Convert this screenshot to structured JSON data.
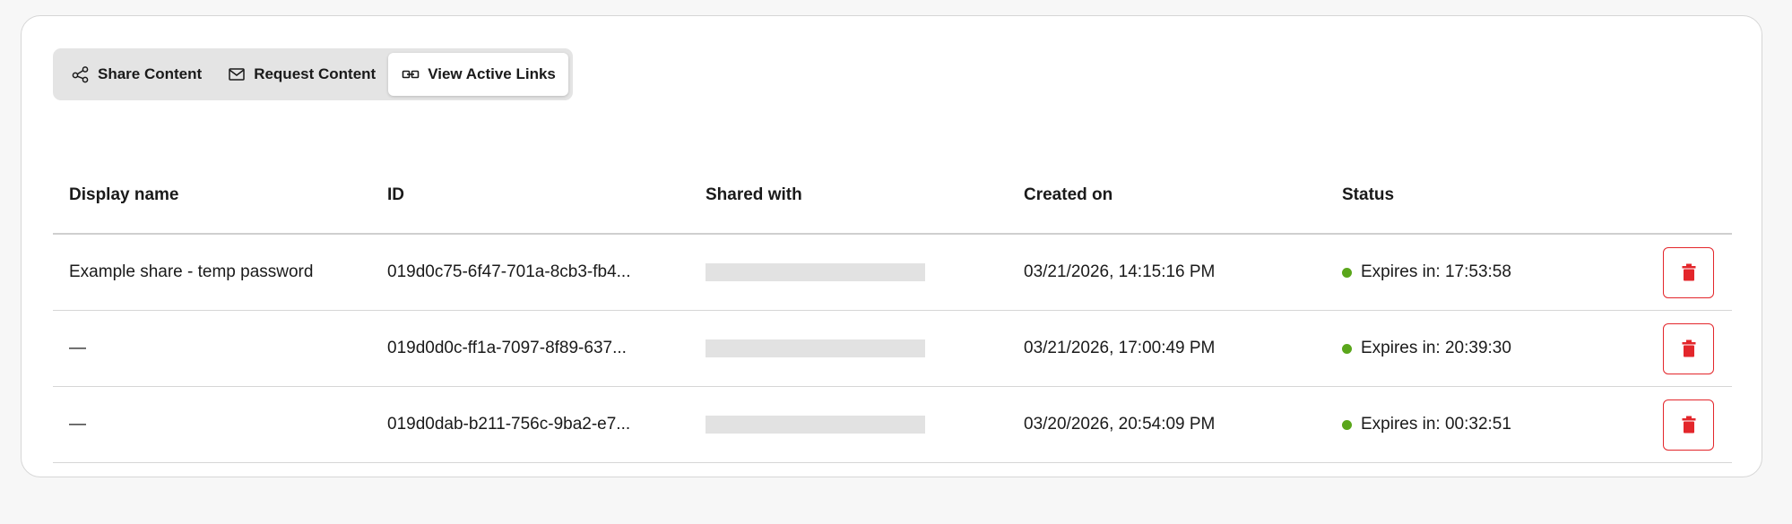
{
  "tabs": [
    {
      "label": "Share Content",
      "icon": "share-icon",
      "active": false
    },
    {
      "label": "Request Content",
      "icon": "mail-icon",
      "active": false
    },
    {
      "label": "View Active Links",
      "icon": "link-icon",
      "active": true
    }
  ],
  "table": {
    "columns": [
      "Display name",
      "ID",
      "Shared with",
      "Created on",
      "Status"
    ],
    "rows": [
      {
        "display_name": "Example share - temp password",
        "id": "019d0c75-6f47-701a-8cb3-fb4...",
        "shared_with": "",
        "created_on": "03/21/2026, 14:15:16 PM",
        "status": "Expires in: 17:53:58"
      },
      {
        "display_name": "—",
        "id": "019d0d0c-ff1a-7097-8f89-637...",
        "shared_with": "",
        "created_on": "03/21/2026, 17:00:49 PM",
        "status": "Expires in: 20:39:30"
      },
      {
        "display_name": "—",
        "id": "019d0dab-b211-756c-9ba2-e7...",
        "shared_with": "",
        "created_on": "03/20/2026, 20:54:09 PM",
        "status": "Expires in: 00:32:51"
      }
    ]
  },
  "colors": {
    "status_active": "#5aa61b",
    "delete_red": "#e3262b"
  }
}
